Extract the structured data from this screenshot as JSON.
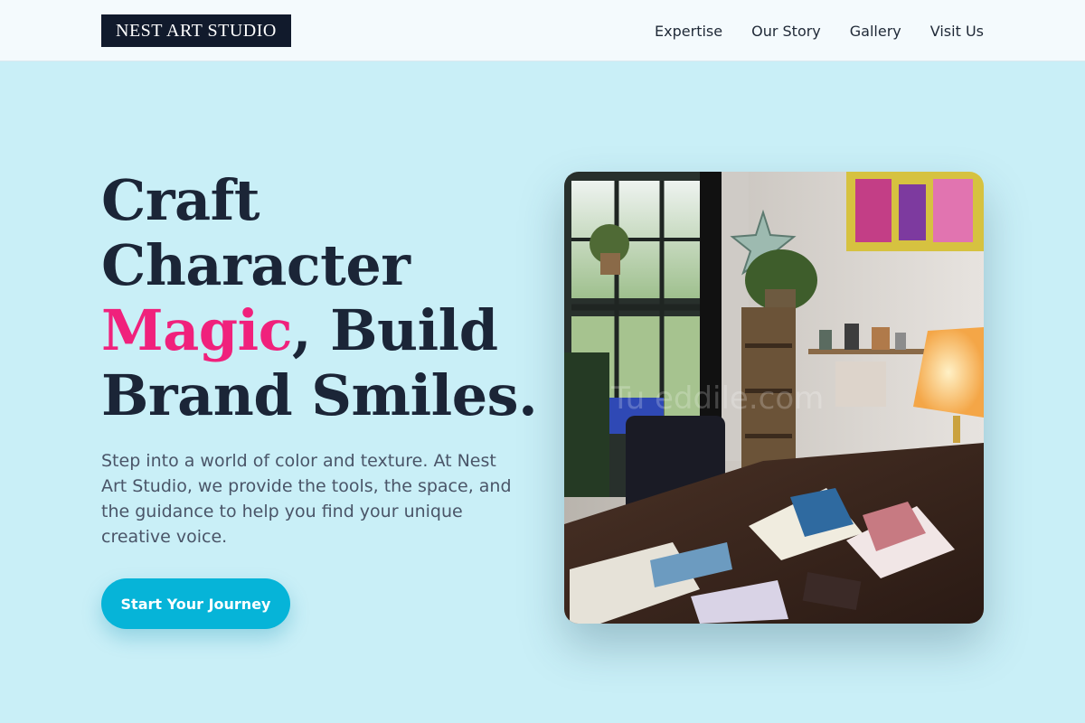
{
  "header": {
    "logo": "NEST ART STUDIO",
    "nav": [
      "Expertise",
      "Our Story",
      "Gallery",
      "Visit Us"
    ]
  },
  "hero": {
    "headline_pre": "Craft Character ",
    "headline_accent": "Magic",
    "headline_post": ", Build Brand Smiles.",
    "description": "Step into a world of color and texture. At Nest Art Studio, we provide the tools, the space, and the guidance to help you find your unique creative voice.",
    "cta_label": "Start Your Journey"
  },
  "colors": {
    "background": "#c9eff7",
    "accent": "#f0217c",
    "cta": "#06b4d8",
    "ink": "#1b2537"
  }
}
